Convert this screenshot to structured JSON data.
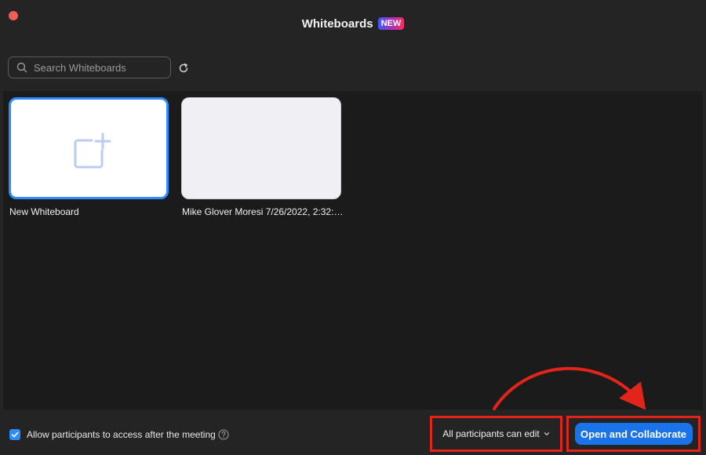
{
  "header": {
    "title": "Whiteboards",
    "badge": "NEW"
  },
  "search": {
    "placeholder": "Search Whiteboards",
    "value": ""
  },
  "cards": [
    {
      "label": "New Whiteboard",
      "icon": "new-whiteboard-icon"
    },
    {
      "label": "Mike Glover Moresi 7/26/2022, 2:32:0..."
    }
  ],
  "footer": {
    "allow_access_label": "Allow participants to access after the meeting",
    "allow_access_checked": true,
    "permission_dropdown": "All participants can edit",
    "primary_button": "Open and Collaborate"
  },
  "colors": {
    "accent": "#2d8cff",
    "primary_button": "#1a73e8",
    "annotation_red": "#e3241b",
    "close_dot": "#ed5f57",
    "background": "#242424"
  }
}
